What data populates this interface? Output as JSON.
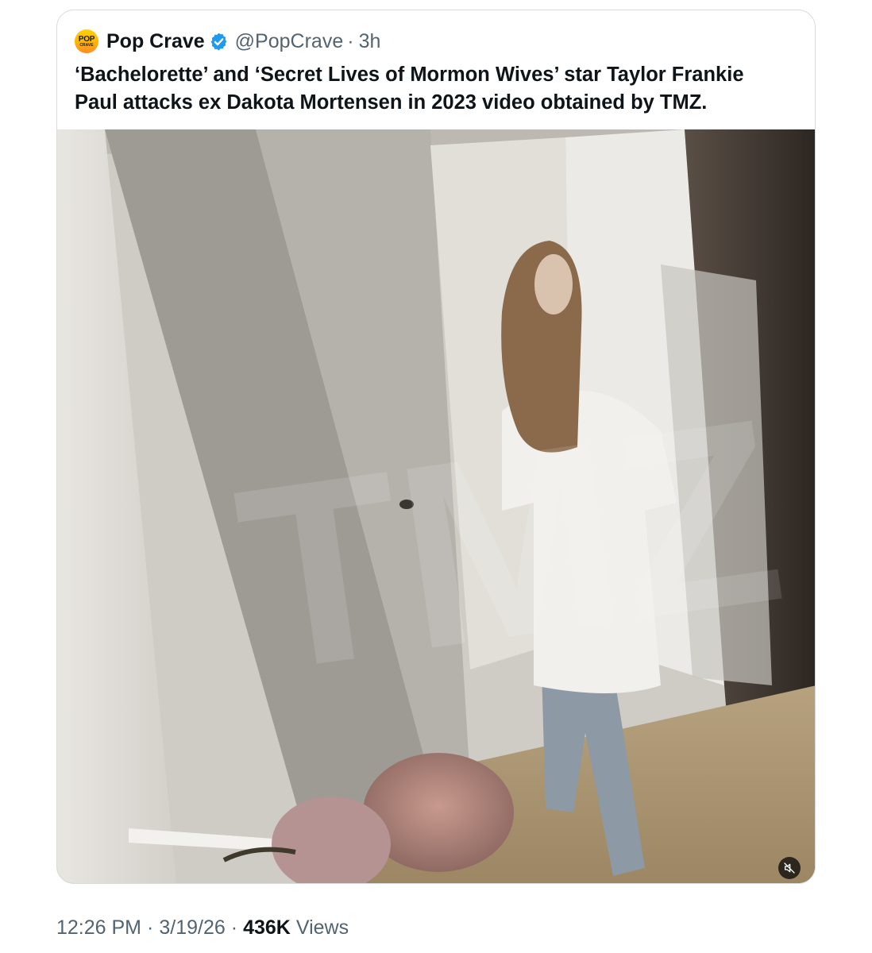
{
  "post": {
    "author": {
      "avatar_text_top": "POP",
      "avatar_text_bottom": "CRAVE",
      "display_name": "Pop Crave",
      "verified": true,
      "handle": "@PopCrave",
      "separator": "·",
      "age": "3h"
    },
    "text_line1": "‘Bachelorette’ and ‘Secret Lives of Mormon Wives’ star Taylor Frankie",
    "text_line2": "Paul attacks ex Dakota Mortensen in 2023 video obtained by TMZ.",
    "media": {
      "type": "video",
      "watermark_text": "TMZ",
      "mute_icon": "speaker-muted-icon"
    },
    "meta": {
      "time": "12:26 PM",
      "sep1": "·",
      "date": "3/19/26",
      "sep2": "·",
      "views_count": "436K",
      "views_label": "Views"
    }
  },
  "colors": {
    "text_primary": "#0f1419",
    "text_secondary": "#536471",
    "verified_blue": "#1d9bf0",
    "border": "#d6dadd"
  }
}
